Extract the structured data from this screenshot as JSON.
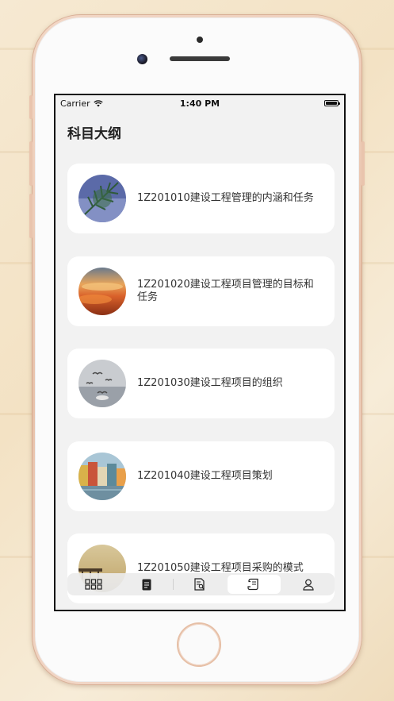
{
  "status_bar": {
    "carrier": "Carrier",
    "time": "1:40 PM"
  },
  "page": {
    "title": "科目大纲"
  },
  "outline_items": [
    {
      "label": "1Z201010建设工程管理的内涵和任务",
      "thumb": "pine-branch-photo"
    },
    {
      "label": "1Z201020建设工程项目管理的目标和任务",
      "thumb": "sunset-clouds-photo"
    },
    {
      "label": "1Z201030建设工程项目的组织",
      "thumb": "seagulls-water-photo"
    },
    {
      "label": "1Z201040建设工程项目策划",
      "thumb": "canal-houses-photo"
    },
    {
      "label": "1Z201050建设工程项目采购的模式",
      "thumb": "pier-sunset-photo"
    }
  ],
  "tab_bar": {
    "tabs": [
      {
        "icon": "grid-icon",
        "active": false
      },
      {
        "icon": "note-icon",
        "active": false
      },
      {
        "icon": "document-search-icon",
        "active": false
      },
      {
        "icon": "scroll-icon",
        "active": true
      },
      {
        "icon": "person-icon",
        "active": false
      }
    ]
  },
  "colors": {
    "screen_bg": "#f2f2f2",
    "card_bg": "#ffffff",
    "phone_frame": "#e8c2aa",
    "text": "#333333"
  }
}
